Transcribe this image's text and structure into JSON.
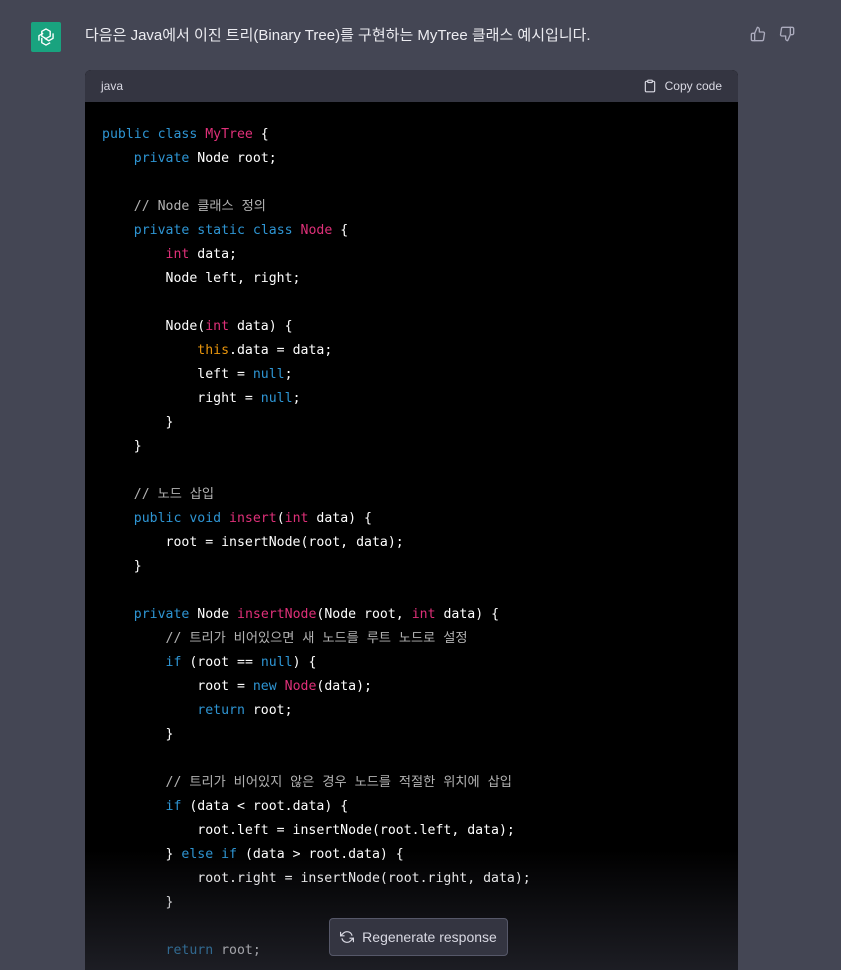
{
  "assistant": {
    "avatar_icon": "openai-logo-icon",
    "message": "다음은 Java에서 이진 트리(Binary Tree)를 구현하는 MyTree 클래스 예시입니다."
  },
  "feedback": {
    "thumbs_up_icon": "thumbs-up-icon",
    "thumbs_down_icon": "thumbs-down-icon"
  },
  "code_block": {
    "language": "java",
    "copy_label": "Copy code",
    "lines": [
      [
        [
          "kw",
          "public "
        ],
        [
          "kw",
          "class "
        ],
        [
          "cls",
          "MyTree"
        ],
        [
          "plain",
          " {"
        ]
      ],
      [
        [
          "plain",
          "    "
        ],
        [
          "kw",
          "private "
        ],
        [
          "plain",
          "Node root;"
        ]
      ],
      [],
      [
        [
          "plain",
          "    "
        ],
        [
          "cmt",
          "// Node 클래스 정의"
        ]
      ],
      [
        [
          "plain",
          "    "
        ],
        [
          "kw",
          "private "
        ],
        [
          "kw",
          "static "
        ],
        [
          "kw",
          "class "
        ],
        [
          "cls",
          "Node"
        ],
        [
          "plain",
          " {"
        ]
      ],
      [
        [
          "plain",
          "        "
        ],
        [
          "type",
          "int"
        ],
        [
          "plain",
          " data;"
        ]
      ],
      [
        [
          "plain",
          "        Node left, right;"
        ]
      ],
      [],
      [
        [
          "plain",
          "        Node("
        ],
        [
          "type",
          "int"
        ],
        [
          "plain",
          " data) {"
        ]
      ],
      [
        [
          "plain",
          "            "
        ],
        [
          "this",
          "this"
        ],
        [
          "plain",
          ".data = data;"
        ]
      ],
      [
        [
          "plain",
          "            left = "
        ],
        [
          "kw",
          "null"
        ],
        [
          "plain",
          ";"
        ]
      ],
      [
        [
          "plain",
          "            right = "
        ],
        [
          "kw",
          "null"
        ],
        [
          "plain",
          ";"
        ]
      ],
      [
        [
          "plain",
          "        }"
        ]
      ],
      [
        [
          "plain",
          "    }"
        ]
      ],
      [],
      [
        [
          "plain",
          "    "
        ],
        [
          "cmt",
          "// 노드 삽입"
        ]
      ],
      [
        [
          "plain",
          "    "
        ],
        [
          "kw",
          "public "
        ],
        [
          "kw",
          "void "
        ],
        [
          "cls",
          "insert"
        ],
        [
          "plain",
          "("
        ],
        [
          "type",
          "int"
        ],
        [
          "plain",
          " data) {"
        ]
      ],
      [
        [
          "plain",
          "        root = insertNode(root, data);"
        ]
      ],
      [
        [
          "plain",
          "    }"
        ]
      ],
      [],
      [
        [
          "plain",
          "    "
        ],
        [
          "kw",
          "private "
        ],
        [
          "plain",
          "Node "
        ],
        [
          "cls",
          "insertNode"
        ],
        [
          "plain",
          "(Node root, "
        ],
        [
          "type",
          "int"
        ],
        [
          "plain",
          " data) {"
        ]
      ],
      [
        [
          "plain",
          "        "
        ],
        [
          "cmt",
          "// 트리가 비어있으면 새 노드를 루트 노드로 설정"
        ]
      ],
      [
        [
          "plain",
          "        "
        ],
        [
          "kw",
          "if"
        ],
        [
          "plain",
          " (root == "
        ],
        [
          "kw",
          "null"
        ],
        [
          "plain",
          ") {"
        ]
      ],
      [
        [
          "plain",
          "            root = "
        ],
        [
          "kw",
          "new "
        ],
        [
          "cls",
          "Node"
        ],
        [
          "plain",
          "(data);"
        ]
      ],
      [
        [
          "plain",
          "            "
        ],
        [
          "kw",
          "return"
        ],
        [
          "plain",
          " root;"
        ]
      ],
      [
        [
          "plain",
          "        }"
        ]
      ],
      [],
      [
        [
          "plain",
          "        "
        ],
        [
          "cmt",
          "// 트리가 비어있지 않은 경우 노드를 적절한 위치에 삽입"
        ]
      ],
      [
        [
          "plain",
          "        "
        ],
        [
          "kw",
          "if"
        ],
        [
          "plain",
          " (data < root.data) {"
        ]
      ],
      [
        [
          "plain",
          "            root.left = insertNode(root.left, data);"
        ]
      ],
      [
        [
          "plain",
          "        } "
        ],
        [
          "kw",
          "else "
        ],
        [
          "kw",
          "if"
        ],
        [
          "plain",
          " (data > root.data) {"
        ]
      ],
      [
        [
          "plain",
          "            root.right = insertNode(root.right, data);"
        ]
      ],
      [
        [
          "plain",
          "        }"
        ]
      ],
      [],
      [
        [
          "plain",
          "        "
        ],
        [
          "kw",
          "return"
        ],
        [
          "plain",
          " root;"
        ]
      ]
    ]
  },
  "regenerate": {
    "label": "Regenerate response",
    "icon": "refresh-icon"
  }
}
